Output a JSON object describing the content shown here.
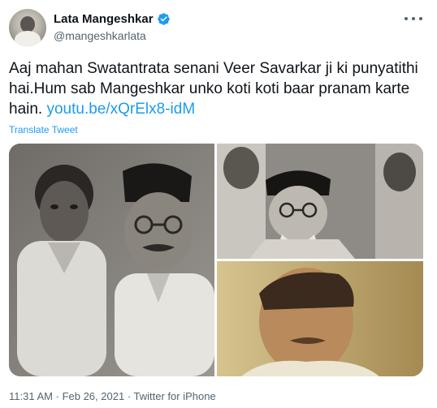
{
  "author": {
    "display_name": "Lata Mangeshkar",
    "handle": "@mangeshkarlata",
    "verified_badge_icon": "verified-badge-icon",
    "avatar_icon": "avatar"
  },
  "tweet": {
    "text": "Aaj mahan Swatantrata senani Veer Savarkar ji ki punyatithi hai.Hum sab Mangeshkar unko koti koti baar pranam karte hain.",
    "link": "youtu.be/xQrElx8-idM",
    "translate_label": "Translate Tweet"
  },
  "meta": {
    "time": "11:31 AM",
    "separator": "·",
    "date": "Feb 26, 2021",
    "source": "Twitter for iPhone"
  },
  "colors": {
    "link": "#1d9bf0",
    "muted": "#536471",
    "text": "#0f1419"
  }
}
